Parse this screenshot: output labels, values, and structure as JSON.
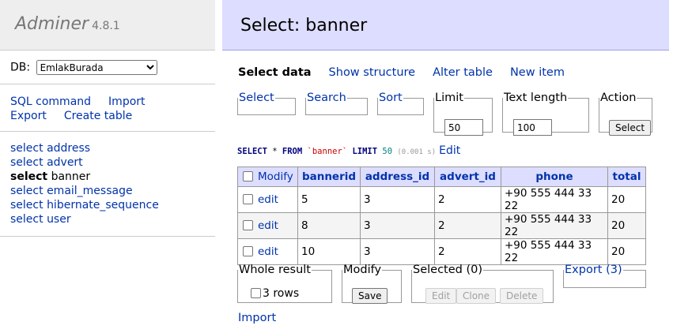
{
  "menu": {
    "brand": "Adminer",
    "version": "4.8.1",
    "db_label": "DB:",
    "db_selected": "EmlakBurada",
    "links": [
      "SQL command",
      "Import",
      "Export",
      "Create table"
    ],
    "tables": [
      {
        "prefix": "select",
        "name": "address"
      },
      {
        "prefix": "select",
        "name": "advert"
      },
      {
        "prefix": "select",
        "name": "banner",
        "active": true
      },
      {
        "prefix": "select",
        "name": "email_message"
      },
      {
        "prefix": "select",
        "name": "hibernate_sequence"
      },
      {
        "prefix": "select",
        "name": "user"
      }
    ]
  },
  "page": {
    "title": "Select: banner",
    "tabs": [
      "Select data",
      "Show structure",
      "Alter table",
      "New item"
    ]
  },
  "filters": {
    "select": "Select",
    "search": "Search",
    "sort": "Sort",
    "limit_label": "Limit",
    "limit_value": "50",
    "text_length_label": "Text length",
    "text_length_value": "100",
    "action_label": "Action",
    "action_button": "Select"
  },
  "query": {
    "kw_select": "SELECT",
    "star": " * ",
    "kw_from": "FROM",
    "table": "`banner`",
    "kw_limit": "LIMIT",
    "limit": "50",
    "time": "(0.001 s)",
    "edit": "Edit"
  },
  "grid": {
    "modify_header": "Modify",
    "columns": [
      "bannerid",
      "address_id",
      "advert_id",
      "phone",
      "total"
    ],
    "edit_label": "edit",
    "rows": [
      [
        "5",
        "3",
        "2",
        "+90 555 444 33 22",
        "20"
      ],
      [
        "8",
        "3",
        "2",
        "+90 555 444 33 22",
        "20"
      ],
      [
        "10",
        "3",
        "2",
        "+90 555 444 33 22",
        "20"
      ]
    ]
  },
  "actions": {
    "whole_result_label": "Whole result",
    "rows_count": "3 rows",
    "modify_label": "Modify",
    "save_button": "Save",
    "selected_label": "Selected (0)",
    "edit_button": "Edit",
    "clone_button": "Clone",
    "delete_button": "Delete",
    "export_label": "Export (3)",
    "import_link": "Import"
  }
}
